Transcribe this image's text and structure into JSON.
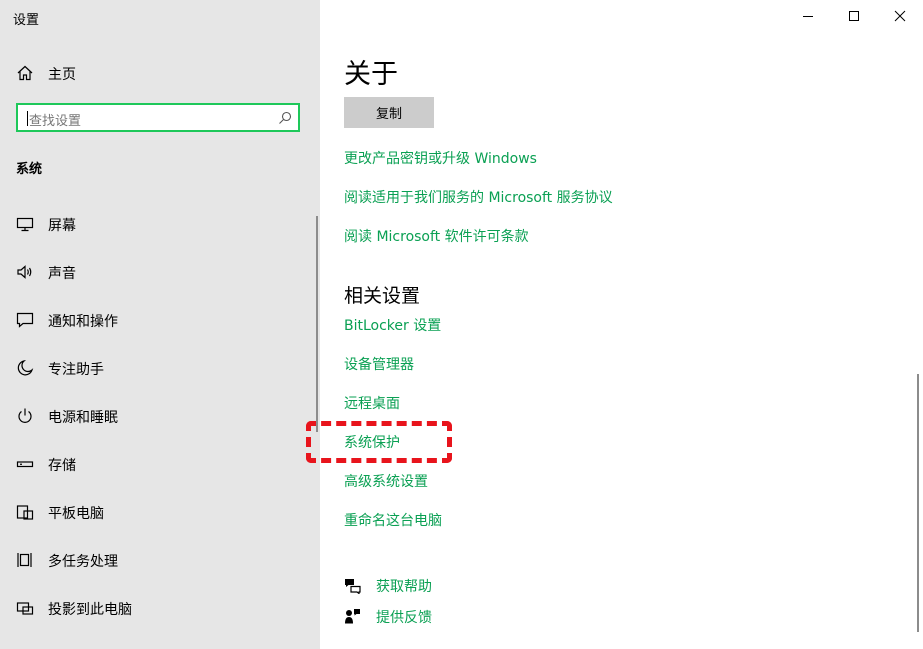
{
  "window": {
    "title": "设置",
    "controls": [
      "minimize",
      "maximize",
      "close"
    ]
  },
  "sidebar": {
    "home_label": "主页",
    "search_placeholder": "查找设置",
    "section_label": "系统",
    "items": [
      {
        "label": "屏幕",
        "icon": "monitor-icon"
      },
      {
        "label": "声音",
        "icon": "speaker-icon"
      },
      {
        "label": "通知和操作",
        "icon": "notification-icon"
      },
      {
        "label": "专注助手",
        "icon": "moon-icon"
      },
      {
        "label": "电源和睡眠",
        "icon": "power-icon"
      },
      {
        "label": "存储",
        "icon": "storage-icon"
      },
      {
        "label": "平板电脑",
        "icon": "tablet-icon"
      },
      {
        "label": "多任务处理",
        "icon": "multitask-icon"
      },
      {
        "label": "投影到此电脑",
        "icon": "project-icon"
      }
    ]
  },
  "main": {
    "title": "关于",
    "copy_button": "复制",
    "links": [
      "更改产品密钥或升级 Windows",
      "阅读适用于我们服务的 Microsoft 服务协议",
      "阅读 Microsoft 软件许可条款"
    ],
    "related_title": "相关设置",
    "related_links": [
      "BitLocker 设置",
      "设备管理器",
      "远程桌面",
      "系统保护",
      "高级系统设置",
      "重命名这台电脑"
    ],
    "help": [
      {
        "label": "获取帮助",
        "icon": "help-chat-icon"
      },
      {
        "label": "提供反馈",
        "icon": "feedback-icon"
      }
    ]
  },
  "colors": {
    "accent": "#0aa053",
    "search_border": "#1ec85a",
    "highlight": "#e8141c",
    "sidebar_bg": "#e6e6e6"
  }
}
